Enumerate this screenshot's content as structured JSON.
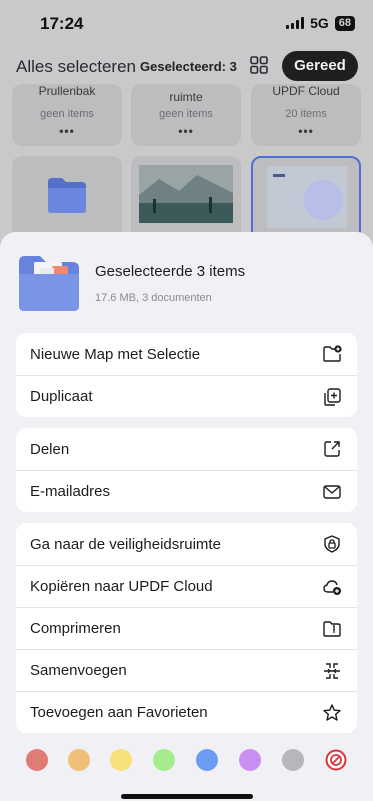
{
  "status_bar": {
    "time": "17:24",
    "network": "5G",
    "battery": "68"
  },
  "topbar": {
    "select_all": "Alles selecteren",
    "selected": "Geselecteerd: 3",
    "done": "Gereed"
  },
  "tiles": [
    {
      "name": "Prullenbak",
      "sub": "geen items",
      "dots": "•••"
    },
    {
      "name": "ruimte",
      "sub": "geen items",
      "dots": "•••"
    },
    {
      "name": "UPDF Cloud",
      "sub": "20 items",
      "dots": "•••"
    }
  ],
  "sheet": {
    "title": "Geselecteerde 3 items",
    "meta": "17.6 MB, 3 documenten",
    "groups": [
      [
        {
          "label": "Nieuwe Map met Selectie",
          "icon": "folder-plus-icon"
        },
        {
          "label": "Duplicaat",
          "icon": "duplicate-icon"
        }
      ],
      [
        {
          "label": "Delen",
          "icon": "share-icon"
        },
        {
          "label": "E-mailadres",
          "icon": "mail-icon"
        }
      ],
      [
        {
          "label": "Ga naar de veiligheidsruimte",
          "icon": "lock-shield-icon"
        },
        {
          "label": "Kopiëren naar UPDF Cloud",
          "icon": "cloud-plus-icon"
        },
        {
          "label": "Comprimeren",
          "icon": "compress-icon"
        },
        {
          "label": "Samenvoegen",
          "icon": "merge-icon"
        },
        {
          "label": "Toevoegen aan Favorieten",
          "icon": "star-icon"
        }
      ]
    ],
    "colors": [
      "#e07b76",
      "#eec07a",
      "#f7e179",
      "#a4ec8e",
      "#6f9cf3",
      "#c88ff1",
      "#b7b7bb",
      "none"
    ]
  }
}
